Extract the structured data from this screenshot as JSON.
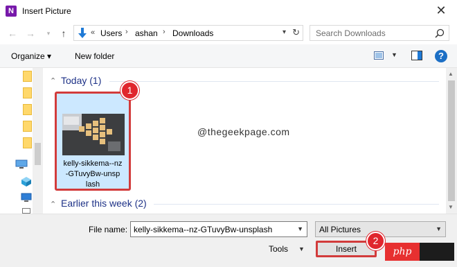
{
  "window": {
    "title": "Insert Picture",
    "app_icon": "N",
    "close_glyph": "✕"
  },
  "address": {
    "prefix": "«",
    "crumbs": [
      "Users",
      "ashan",
      "Downloads"
    ],
    "separator": "›",
    "search_placeholder": "Search Downloads"
  },
  "toolbar": {
    "organize": "Organize ▾",
    "new_folder": "New folder",
    "help": "?"
  },
  "groups": [
    {
      "label": "Today (1)"
    },
    {
      "label": "Earlier this week (2)"
    }
  ],
  "file": {
    "name_line1": "kelly-sikkema--nz",
    "name_line2": "-GTuvyBw-unsp",
    "name_line3": "lash"
  },
  "watermark": "@thegeekpage.com",
  "bottom": {
    "file_name_label": "File name:",
    "file_name_value": "kelly-sikkema--nz-GTuvyBw-unsplash",
    "filter": "All Pictures",
    "tools": "Tools",
    "insert": "Insert"
  },
  "badges": [
    "1",
    "2"
  ],
  "logo_text": "php",
  "colors": {
    "accent_red": "#d23b3b",
    "selection": "#cce8ff",
    "group_header": "#1e3287"
  }
}
